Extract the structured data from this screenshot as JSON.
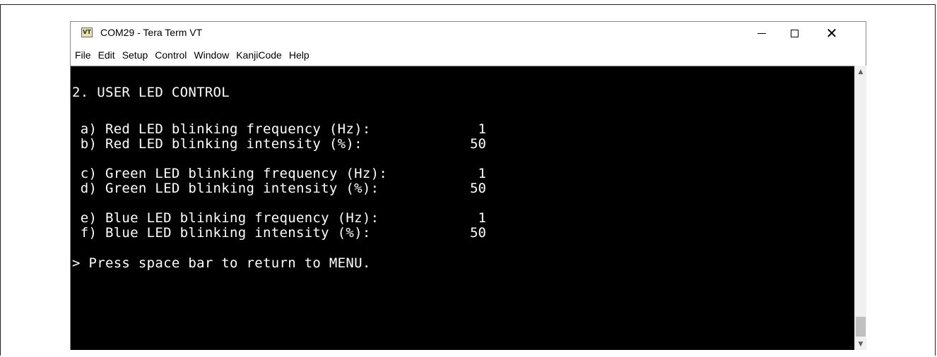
{
  "window": {
    "title": "COM29 - Tera Term VT",
    "icon_label": "VT",
    "controls": {
      "minimize": "minimize",
      "maximize": "maximize",
      "close": "close"
    }
  },
  "menu": {
    "items": [
      "File",
      "Edit",
      "Setup",
      "Control",
      "Window",
      "KanjiCode",
      "Help"
    ]
  },
  "terminal": {
    "heading": "2. USER LED CONTROL",
    "rows": [
      {
        "label": " a) Red LED blinking frequency (Hz):",
        "value": "1"
      },
      {
        "label": " b) Red LED blinking intensity (%):",
        "value": "50"
      },
      {
        "label": " c) Green LED blinking frequency (Hz):",
        "value": "1"
      },
      {
        "label": " d) Green LED blinking intensity (%):",
        "value": "50"
      },
      {
        "label": " e) Blue LED blinking frequency (Hz):",
        "value": "1"
      },
      {
        "label": " f) Blue LED blinking intensity (%):",
        "value": "50"
      }
    ],
    "prompt": "> Press space bar to return to MENU."
  },
  "scrollbar": {
    "up_icon": "chevron-up-icon",
    "down_icon": "chevron-down-icon"
  },
  "colors": {
    "terminal_bg": "#000000",
    "terminal_fg": "#ffffff"
  }
}
